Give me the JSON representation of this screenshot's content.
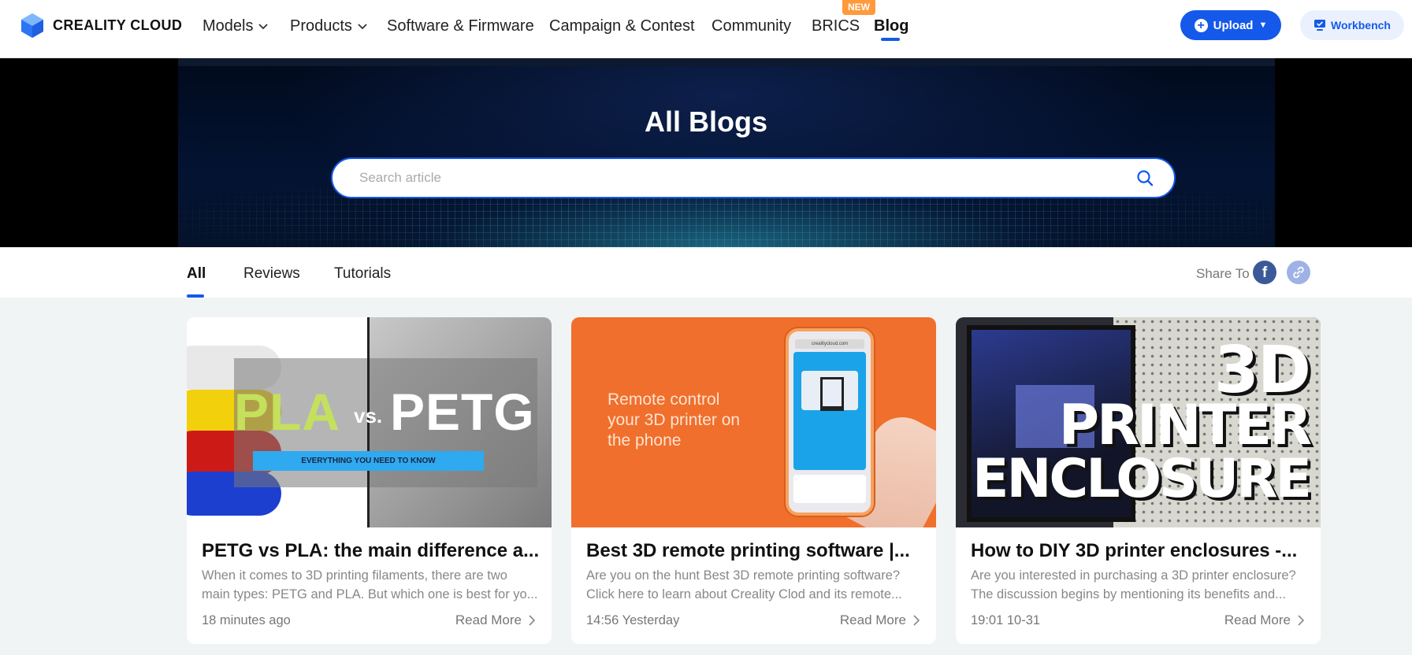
{
  "header": {
    "logo_text": "CREALITY CLOUD",
    "nav": [
      {
        "label": "Models"
      },
      {
        "label": "Products"
      },
      {
        "label": "Software & Firmware"
      },
      {
        "label": "Campaign & Contest"
      },
      {
        "label": "Community"
      },
      {
        "label": "BRICS"
      },
      {
        "label": "Blog"
      }
    ],
    "new_badge": "NEW",
    "upload_label": "Upload",
    "workbench_label": "Workbench"
  },
  "hero": {
    "title": "All Blogs",
    "search_placeholder": "Search article"
  },
  "tabs": [
    {
      "label": "All"
    },
    {
      "label": "Reviews"
    },
    {
      "label": "Tutorials"
    }
  ],
  "share_label": "Share To",
  "colors": {
    "accent": "#1559ea",
    "new_badge": "#ff9a3c",
    "facebook": "#3b5998"
  },
  "cards": [
    {
      "title": "PETG vs PLA: the main difference a...",
      "desc_line1": "When it comes to 3D printing filaments, there are two",
      "desc_line2": "main types: PETG and PLA. But which one is best for yo...",
      "time": "18 minutes ago",
      "read_more": "Read More",
      "image_text": {
        "left": "PLA",
        "vs": "vs.",
        "right": "PETG",
        "banner": "EVERYTHING YOU NEED TO KNOW"
      }
    },
    {
      "title": "Best 3D remote printing software |...",
      "desc_line1": "Are you on the hunt Best 3D remote printing software?",
      "desc_line2": "Click here to learn about Creality Clod and its remote...",
      "time": "14:56 Yesterday",
      "read_more": "Read More",
      "image_text": {
        "line1": "Remote control",
        "line2": "your 3D printer on",
        "line3": "the phone",
        "url": "crealitycloud.com"
      }
    },
    {
      "title": "How to DIY 3D printer enclosures -...",
      "desc_line1": "Are you interested in purchasing a 3D printer enclosure?",
      "desc_line2": "The discussion begins by mentioning its benefits and...",
      "time": "19:01 10-31",
      "read_more": "Read More",
      "image_text": {
        "line1": "3D",
        "line2": "PRINTER",
        "line3": "ENCLOSURE"
      }
    }
  ]
}
